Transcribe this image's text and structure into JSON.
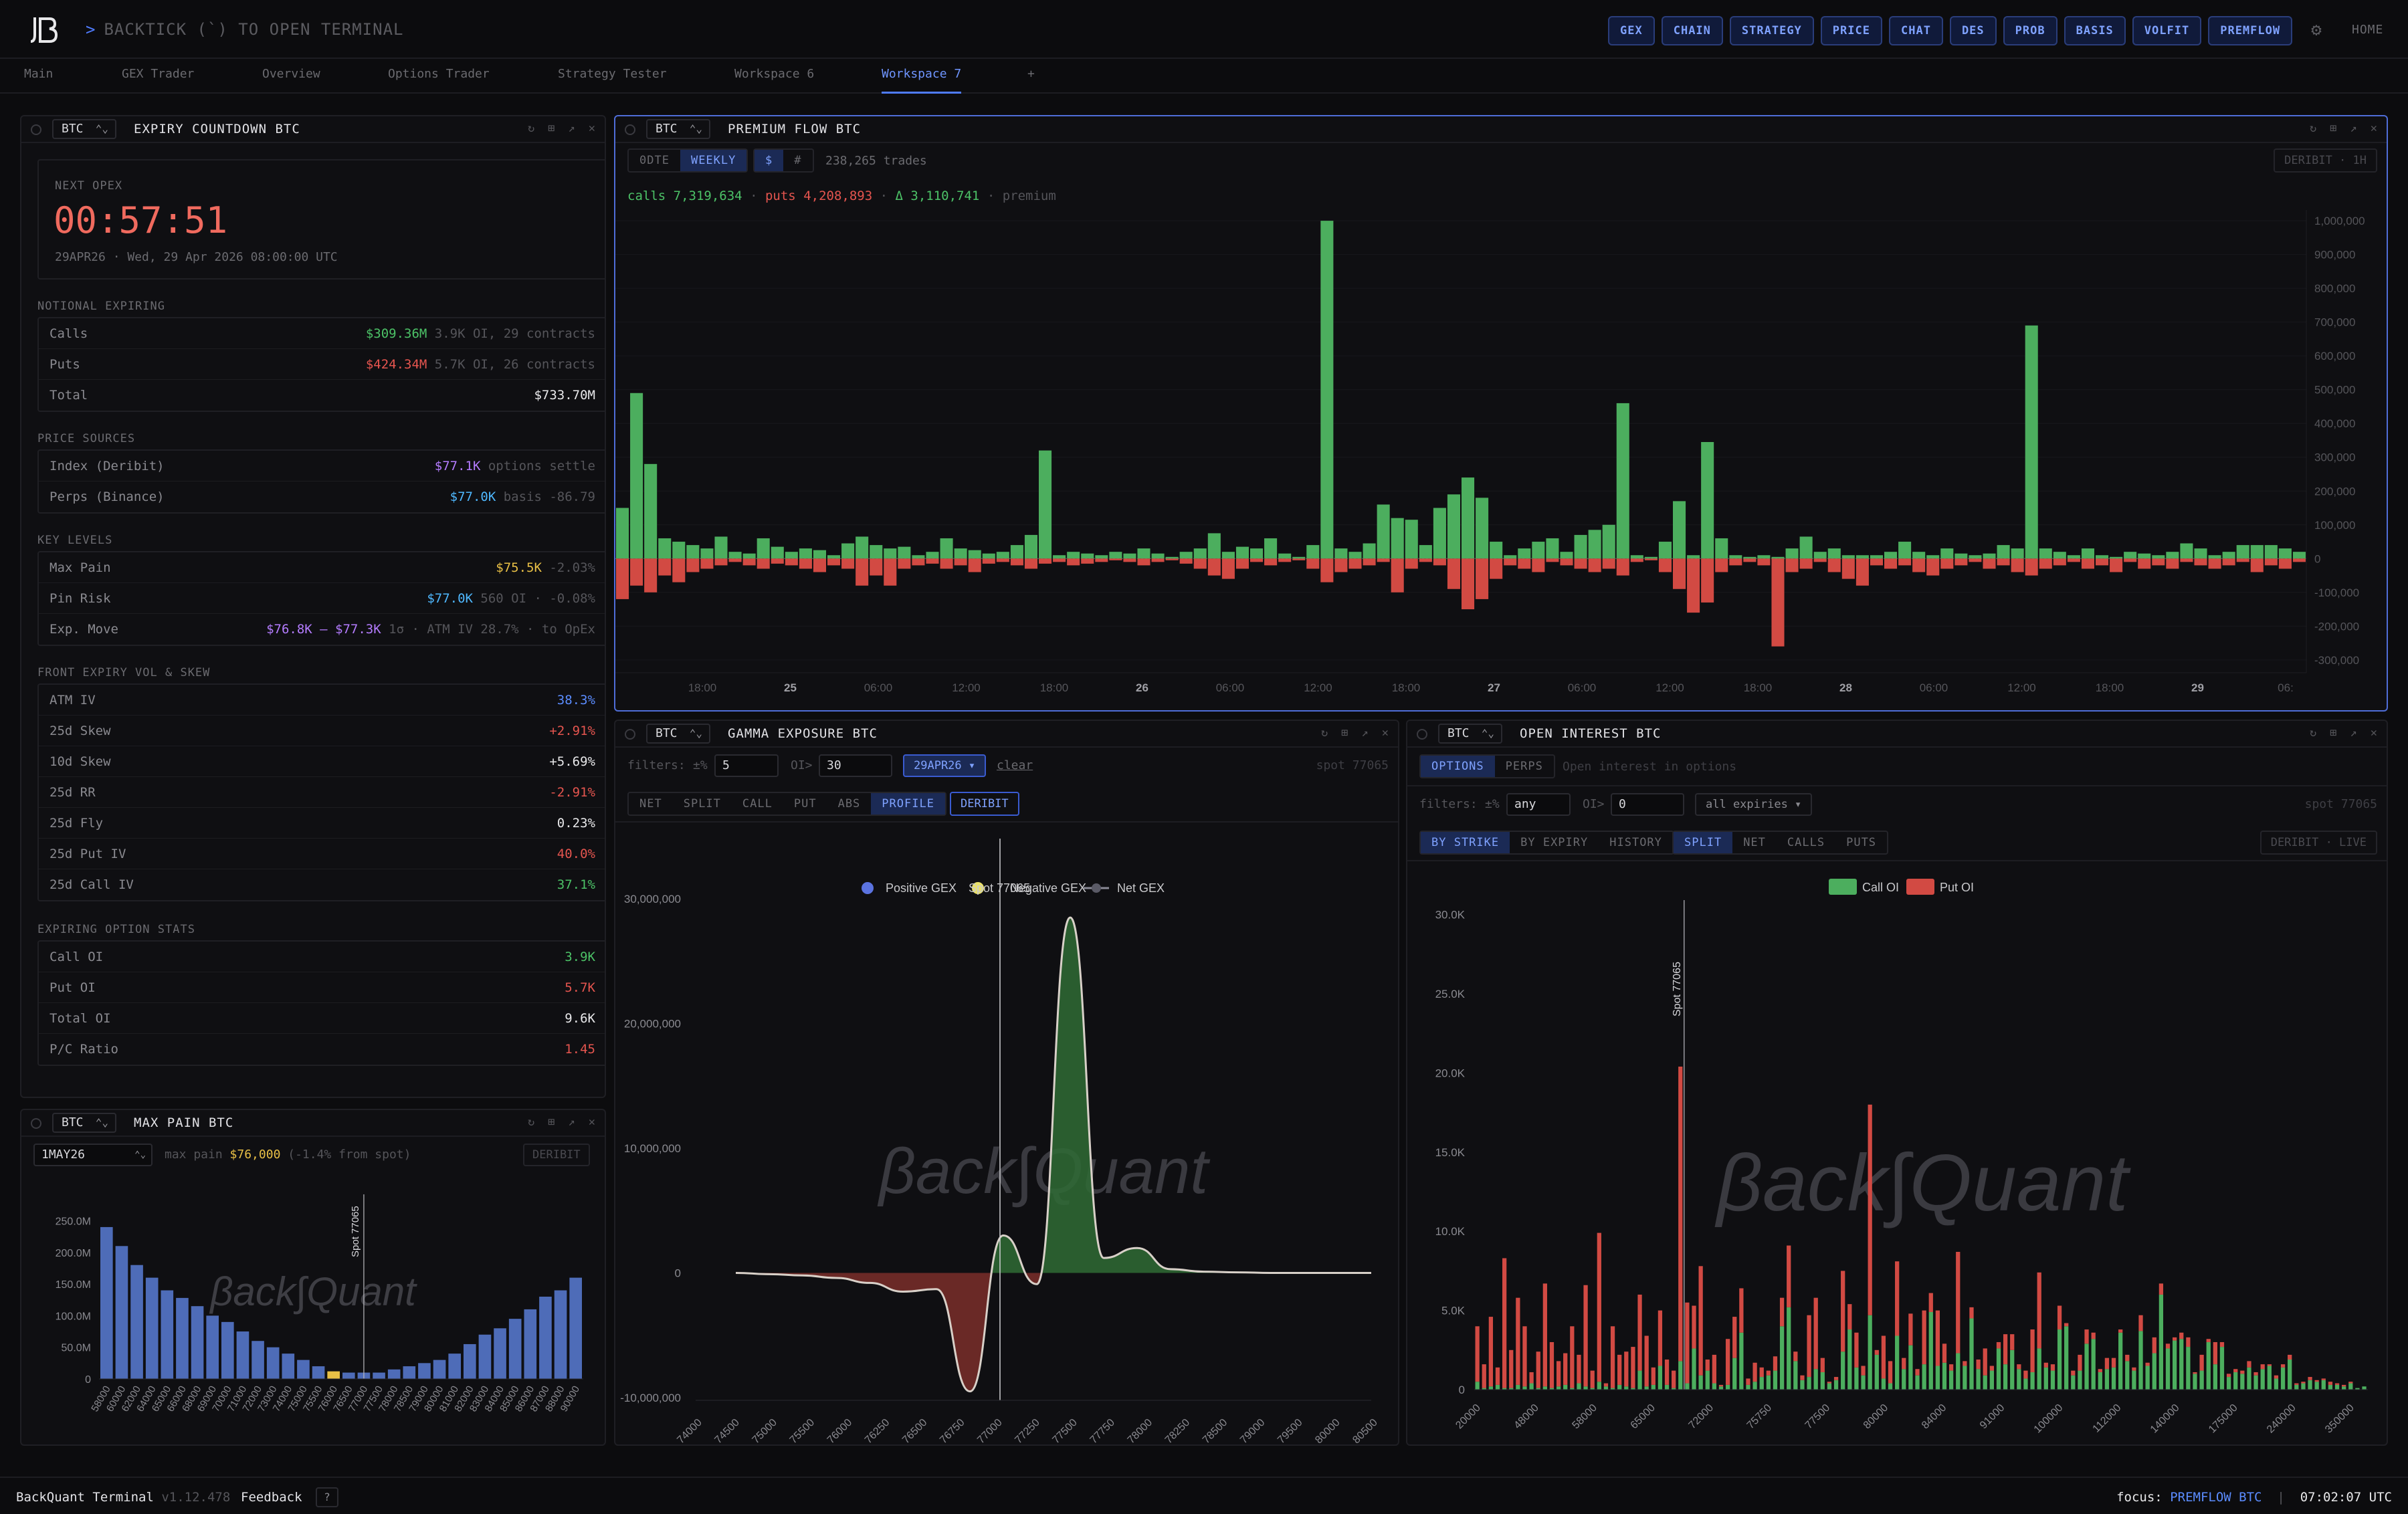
{
  "app": {
    "hint_prefix": ">",
    "hint": "BACKTICK (`) TO OPEN TERMINAL",
    "home": "HOME"
  },
  "quicknav": [
    "GEX",
    "CHAIN",
    "STRATEGY",
    "PRICE",
    "CHAT",
    "DES",
    "PROB",
    "BASIS",
    "VOLFIT",
    "PREMFLOW"
  ],
  "tabs": [
    {
      "label": "Main",
      "x": 36
    },
    {
      "label": "GEX Trader",
      "x": 182
    },
    {
      "label": "Overview",
      "x": 392
    },
    {
      "label": "Options Trader",
      "x": 580
    },
    {
      "label": "Strategy Tester",
      "x": 834
    },
    {
      "label": "Workspace 6",
      "x": 1098
    },
    {
      "label": "Workspace 7",
      "x": 1318,
      "active": true
    },
    {
      "label": "+",
      "x": 1536
    }
  ],
  "expiry": {
    "asset": "BTC",
    "title": "EXPIRY COUNTDOWN BTC",
    "next_label": "NEXT OPEX",
    "countdown": "00:57:51",
    "date": "29APR26 · Wed, 29 Apr 2026 08:00:00 UTC",
    "notional_head": "NOTIONAL EXPIRING",
    "calls_k": "Calls",
    "calls_v": "$309.36M",
    "calls_d": "3.9K OI, 29 contracts",
    "puts_k": "Puts",
    "puts_v": "$424.34M",
    "puts_d": "5.7K OI, 26 contracts",
    "total_k": "Total",
    "total_v": "$733.70M",
    "price_head": "PRICE SOURCES",
    "index_k": "Index (Deribit)",
    "index_v": "$77.1K",
    "index_d": "options settle",
    "perps_k": "Perps (Binance)",
    "perps_v": "$77.0K",
    "perps_d": "basis -86.79",
    "levels_head": "KEY LEVELS",
    "maxpain_k": "Max Pain",
    "maxpain_v": "$75.5K",
    "maxpain_d": "-2.03%",
    "pin_k": "Pin Risk",
    "pin_v": "$77.0K",
    "pin_d": "560 OI · -0.08%",
    "move_k": "Exp. Move",
    "move_v": "$76.8K – $77.3K",
    "move_d": "1σ · ATM IV 28.7% · to OpEx",
    "vol_head": "FRONT EXPIRY VOL & SKEW",
    "atm_k": "ATM IV",
    "atm_v": "38.3%",
    "s25_k": "25d Skew",
    "s25_v": "+2.91%",
    "s10_k": "10d Skew",
    "s10_v": "+5.69%",
    "rr_k": "25d RR",
    "rr_v": "-2.91%",
    "fly_k": "25d Fly",
    "fly_v": "0.23%",
    "piv_k": "25d Put IV",
    "piv_v": "40.0%",
    "civ_k": "25d Call IV",
    "civ_v": "37.1%",
    "stats_head": "EXPIRING OPTION STATS",
    "coi_k": "Call OI",
    "coi_v": "3.9K",
    "poi_k": "Put OI",
    "poi_v": "5.7K",
    "toi_k": "Total OI",
    "toi_v": "9.6K",
    "pc_k": "P/C Ratio",
    "pc_v": "1.45"
  },
  "maxpain": {
    "asset": "BTC",
    "title": "MAX PAIN BTC",
    "expiry": "1MAY26",
    "label": "max pain",
    "value": "$76,000",
    "delta": "(-1.4% from spot)",
    "source": "DERIBIT",
    "spot_label": "Spot 77065",
    "watermark": "βack∫Quant"
  },
  "premium": {
    "asset": "BTC",
    "title": "PREMIUM FLOW BTC",
    "b1": "0DTE",
    "b2": "WEEKLY",
    "b3": "$",
    "b4": "#",
    "trades": "238,265 trades",
    "source": "DERIBIT · 1H",
    "calls_label": "calls",
    "calls": "7,319,634",
    "puts_label": "puts",
    "puts": "4,208,893",
    "delta_label": "Δ",
    "delta": "3,110,741",
    "premium": "premium"
  },
  "gamma": {
    "asset": "BTC",
    "title": "GAMMA EXPOSURE BTC",
    "filters": "filters:",
    "pct": "±%",
    "pct_v": "5",
    "oi": "OI>",
    "oi_v": "30",
    "expiry": "29APR26 ▾",
    "clear": "clear",
    "spot": "spot 77065",
    "modes": [
      "NET",
      "SPLIT",
      "CALL",
      "PUT",
      "ABS",
      "PROFILE"
    ],
    "deribit": "DERIBIT",
    "legend": [
      "Positive GEX",
      "Spot 77065",
      "Negative GEX",
      "Net GEX"
    ],
    "watermark": "βack∫Quant"
  },
  "oi": {
    "asset": "BTC",
    "title": "OPEN INTEREST BTC",
    "t1": "OPTIONS",
    "t2": "PERPS",
    "note": "Open interest in options",
    "filters": "filters:",
    "pct": "±%",
    "pct_v": "any",
    "oi": "OI>",
    "oi_v": "0",
    "expiry": "all expiries ▾",
    "spot": "spot 77065",
    "views": [
      "BY STRIKE",
      "BY EXPIRY",
      "HISTORY"
    ],
    "modes": [
      "SPLIT",
      "NET",
      "CALLS",
      "PUTS"
    ],
    "source": "DERIBIT · LIVE",
    "legend_call": "Call OI",
    "legend_put": "Put OI",
    "spot_label": "Spot 77065",
    "watermark": "βack∫Quant"
  },
  "status": {
    "app": "BackQuant Terminal",
    "version": "v1.12.478",
    "feedback": "Feedback",
    "help": "?",
    "focus_label": "focus:",
    "focus": "PREMFLOW BTC",
    "sep": "|",
    "time": "07:02:07 UTC"
  },
  "colors": {
    "call": "#4cae5e",
    "put": "#d24a43",
    "accent": "#4f7cff",
    "bar_blue": "#4e6cb8"
  },
  "chart_data": [
    {
      "type": "bar",
      "id": "premium_flow",
      "title": "PREMIUM FLOW BTC",
      "x_ticks": [
        "18:00",
        "25",
        "06:00",
        "12:00",
        "18:00",
        "26",
        "06:00",
        "12:00",
        "18:00",
        "27",
        "06:00",
        "12:00",
        "18:00",
        "28",
        "06:00",
        "12:00",
        "18:00",
        "29",
        "06:"
      ],
      "y_ticks": [
        "1,000,000",
        "900,000",
        "800,000",
        "700,000",
        "600,000",
        "500,000",
        "400,000",
        "300,000",
        "200,000",
        "100,000",
        "0",
        "-100,000",
        "-200,000",
        "-300,000"
      ],
      "ylim": [
        -330000,
        1020000
      ],
      "series": [
        {
          "name": "calls",
          "values": [
            150000,
            490000,
            280000,
            60000,
            50000,
            40000,
            30000,
            65000,
            20000,
            15000,
            60000,
            35000,
            20000,
            30000,
            25000,
            10000,
            45000,
            65000,
            40000,
            30000,
            35000,
            10000,
            20000,
            60000,
            30000,
            25000,
            15000,
            20000,
            40000,
            70000,
            320000,
            10000,
            20000,
            15000,
            10000,
            20000,
            15000,
            30000,
            15000,
            5000,
            20000,
            30000,
            75000,
            20000,
            35000,
            30000,
            60000,
            15000,
            5000,
            40000,
            1000000,
            30000,
            20000,
            45000,
            160000,
            120000,
            115000,
            40000,
            150000,
            190000,
            240000,
            180000,
            50000,
            10000,
            30000,
            50000,
            60000,
            20000,
            70000,
            85000,
            100000,
            460000,
            10000,
            5000,
            50000,
            170000,
            10000,
            345000,
            60000,
            10000,
            5000,
            10000,
            5000,
            30000,
            65000,
            20000,
            30000,
            10000,
            10000,
            10000,
            20000,
            50000,
            20000,
            10000,
            30000,
            15000,
            10000,
            15000,
            40000,
            30000,
            690000,
            30000,
            20000,
            10000,
            30000,
            10000,
            5000,
            20000,
            15000,
            10000,
            20000,
            45000,
            30000,
            10000,
            20000,
            40000,
            40000,
            40000,
            30000,
            20000
          ]
        },
        {
          "name": "puts",
          "values": [
            -120000,
            -80000,
            -100000,
            -50000,
            -70000,
            -40000,
            -30000,
            -20000,
            -10000,
            -20000,
            -30000,
            -15000,
            -20000,
            -30000,
            -40000,
            -20000,
            -30000,
            -80000,
            -50000,
            -80000,
            -30000,
            -20000,
            -15000,
            -30000,
            -20000,
            -40000,
            -15000,
            -10000,
            -20000,
            -30000,
            -15000,
            -10000,
            -20000,
            -15000,
            -10000,
            -5000,
            -10000,
            -20000,
            -10000,
            -5000,
            -15000,
            -30000,
            -50000,
            -60000,
            -30000,
            -10000,
            -20000,
            -10000,
            -5000,
            -30000,
            -70000,
            -40000,
            -30000,
            -20000,
            -10000,
            -100000,
            -30000,
            -10000,
            -20000,
            -90000,
            -150000,
            -120000,
            -60000,
            -20000,
            -30000,
            -40000,
            -10000,
            -20000,
            -30000,
            -40000,
            -30000,
            -50000,
            -10000,
            -5000,
            -40000,
            -90000,
            -160000,
            -130000,
            -40000,
            -20000,
            -10000,
            -20000,
            -260000,
            -40000,
            -30000,
            -10000,
            -40000,
            -60000,
            -80000,
            -20000,
            -30000,
            -20000,
            -40000,
            -50000,
            -30000,
            -20000,
            -10000,
            -30000,
            -20000,
            -40000,
            -50000,
            -30000,
            -20000,
            -10000,
            -30000,
            -20000,
            -40000,
            -10000,
            -30000,
            -20000,
            -30000,
            -10000,
            -20000,
            -30000,
            -20000,
            -10000,
            -40000,
            -20000,
            -30000,
            -10000
          ]
        }
      ]
    },
    {
      "type": "area",
      "id": "gamma_exposure",
      "title": "GAMMA EXPOSURE BTC",
      "x_ticks": [
        "74000",
        "74500",
        "75000",
        "75500",
        "76000",
        "76250",
        "76500",
        "76750",
        "77000",
        "77250",
        "77500",
        "77750",
        "78000",
        "78250",
        "78500",
        "79000",
        "79500",
        "80000",
        "80500"
      ],
      "y_ticks": [
        "30,000,000",
        "20,000,000",
        "10,000,000",
        "0",
        "-10,000,000"
      ],
      "ylim": [
        -10000000,
        30000000
      ],
      "spot_index": 7.9,
      "net_gex": [
        0,
        -100000,
        -200000,
        -400000,
        -800000,
        -1500000,
        -1300000,
        -9500000,
        3000000,
        -900000,
        28500000,
        1200000,
        2000000,
        300000,
        100000,
        50000,
        0,
        0,
        0,
        0
      ]
    },
    {
      "type": "bar",
      "id": "open_interest",
      "title": "OPEN INTEREST BTC",
      "categories": [
        "20000",
        "48000",
        "58000",
        "65000",
        "72000",
        "75750",
        "77500",
        "80000",
        "84000",
        "91000",
        "100000",
        "112000",
        "140000",
        "175000",
        "240000",
        "350000"
      ],
      "y_ticks": [
        "30.0K",
        "25.0K",
        "20.0K",
        "15.0K",
        "10.0K",
        "5.0K",
        "0"
      ],
      "ylim": [
        0,
        31000
      ],
      "series": [
        {
          "name": "Call OI",
          "values": [
            500,
            100,
            200,
            300,
            100,
            100,
            300,
            200,
            400,
            100,
            200,
            100,
            200,
            300,
            100,
            400,
            200,
            100,
            500,
            200,
            100,
            300,
            200,
            100,
            1200,
            200,
            300,
            1500,
            300,
            100,
            1800,
            400,
            2600,
            900,
            1200,
            400,
            200,
            300,
            2000,
            3600,
            300,
            500,
            800,
            900,
            1200,
            4000,
            5200,
            1800,
            600,
            800,
            1300,
            1100,
            400,
            600,
            2400,
            3800,
            1400,
            900,
            4700,
            2200,
            700,
            400,
            3400,
            1300,
            2800,
            900,
            1600,
            4900,
            1500,
            1700,
            1200,
            2300,
            1500,
            4500,
            1300,
            900,
            1200,
            2600,
            1600,
            2500,
            1300,
            700,
            1100,
            2600,
            1400,
            1200,
            3800,
            4000,
            900,
            1200,
            2900,
            3200,
            1100,
            1300,
            1400,
            3600,
            1800,
            1200,
            3700,
            1500,
            2300,
            6000,
            2600,
            3100,
            3200,
            2700,
            1000,
            1200,
            3000,
            1600,
            2700,
            800,
            1100,
            1000,
            1400,
            900,
            1300,
            1500,
            700,
            1400,
            1900,
            300,
            400,
            600,
            500,
            600,
            300,
            300,
            200,
            400,
            100,
            200
          ]
        },
        {
          "name": "Put OI",
          "values": [
            3500,
            1500,
            4400,
            1100,
            8200,
            2400,
            5500,
            3800,
            700,
            2300,
            6500,
            2900,
            1600,
            2000,
            3900,
            1800,
            6400,
            1100,
            9400,
            200,
            3900,
            1900,
            2200,
            2600,
            4800,
            3200,
            1100,
            3500,
            1600,
            1100,
            18600,
            5100,
            2700,
            6900,
            700,
            1800,
            100,
            2900,
            2600,
            2800,
            400,
            1200,
            600,
            300,
            900,
            1800,
            3900,
            600,
            300,
            3900,
            4500,
            900,
            100,
            200,
            5100,
            1600,
            2200,
            600,
            13300,
            300,
            2700,
            1400,
            4700,
            700,
            2000,
            400,
            3400,
            1200,
            3500,
            1200,
            400,
            6400,
            300,
            700,
            600,
            1700,
            300,
            400,
            1900,
            1000,
            300,
            500,
            2700,
            4800,
            300,
            400,
            1500,
            200,
            300,
            1000,
            900,
            400,
            200,
            700,
            600,
            200,
            400,
            200,
            1000,
            200,
            1000,
            700,
            300,
            200,
            400,
            600,
            100,
            1000,
            200,
            1400,
            300,
            200,
            200,
            200,
            400,
            200,
            300,
            100,
            200,
            200,
            300,
            100,
            100,
            200,
            100,
            100,
            200,
            100,
            100,
            100
          ]
        }
      ]
    },
    {
      "type": "bar",
      "id": "max_pain",
      "title": "MAX PAIN BTC",
      "categories": [
        "58000",
        "60000",
        "62000",
        "64000",
        "65000",
        "66000",
        "68000",
        "69000",
        "70000",
        "71000",
        "72000",
        "73000",
        "74000",
        "75000",
        "75500",
        "76000",
        "76500",
        "77000",
        "77500",
        "78000",
        "78500",
        "79000",
        "80000",
        "81000",
        "82000",
        "83000",
        "84000",
        "85000",
        "86000",
        "87000",
        "88000",
        "90000"
      ],
      "y_ticks": [
        "250.0M",
        "200.0M",
        "150.0M",
        "100.0M",
        "50.0M",
        "0"
      ],
      "ylim": [
        0,
        260
      ],
      "values": [
        240,
        210,
        180,
        160,
        140,
        128,
        115,
        100,
        90,
        75,
        60,
        50,
        40,
        30,
        20,
        12,
        10,
        10,
        10,
        15,
        20,
        25,
        30,
        40,
        55,
        70,
        80,
        95,
        110,
        130,
        140,
        160
      ],
      "highlight_index": 15
    }
  ]
}
